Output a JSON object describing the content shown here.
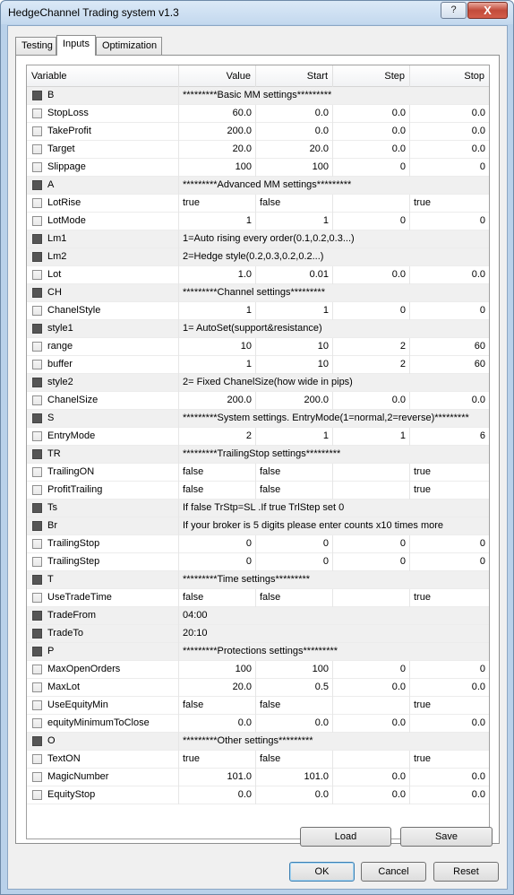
{
  "window": {
    "title": "HedgeChannel Trading system v1.3",
    "help_label": "?",
    "close_label": "X"
  },
  "tabs": [
    {
      "label": "Testing"
    },
    {
      "label": "Inputs"
    },
    {
      "label": "Optimization"
    }
  ],
  "columns": {
    "variable": "Variable",
    "value": "Value",
    "start": "Start",
    "step": "Step",
    "stop": "Stop"
  },
  "rows": [
    {
      "name": "B",
      "section": true,
      "text": "*********Basic MM settings*********"
    },
    {
      "name": "StopLoss",
      "cells": [
        "60.0",
        "0.0",
        "0.0",
        "0.0"
      ]
    },
    {
      "name": "TakeProfit",
      "cells": [
        "200.0",
        "0.0",
        "0.0",
        "0.0"
      ]
    },
    {
      "name": "Target",
      "cells": [
        "20.0",
        "20.0",
        "0.0",
        "0.0"
      ]
    },
    {
      "name": "Slippage",
      "cells": [
        "100",
        "100",
        "0",
        "0"
      ]
    },
    {
      "name": "A",
      "section": true,
      "text": "*********Advanced MM settings*********"
    },
    {
      "name": "LotRise",
      "bool": true,
      "cells": [
        "true",
        "false",
        "",
        "true"
      ]
    },
    {
      "name": "LotMode",
      "cells": [
        "1",
        "1",
        "0",
        "0"
      ]
    },
    {
      "name": "Lm1",
      "section": true,
      "text": "1=Auto rising every order(0.1,0.2,0.3...)"
    },
    {
      "name": "Lm2",
      "section": true,
      "text": "2=Hedge style(0.2,0.3,0.2,0.2...)"
    },
    {
      "name": "Lot",
      "cells": [
        "1.0",
        "0.01",
        "0.0",
        "0.0"
      ]
    },
    {
      "name": "CH",
      "section": true,
      "text": "*********Channel settings*********"
    },
    {
      "name": "ChanelStyle",
      "cells": [
        "1",
        "1",
        "0",
        "0"
      ]
    },
    {
      "name": "style1",
      "section": true,
      "text": "1= AutoSet(support&resistance)"
    },
    {
      "name": "range",
      "cells": [
        "10",
        "10",
        "2",
        "60"
      ]
    },
    {
      "name": "buffer",
      "cells": [
        "1",
        "10",
        "2",
        "60"
      ]
    },
    {
      "name": "style2",
      "section": true,
      "text": "2= Fixed ChanelSize(how wide in pips)"
    },
    {
      "name": "ChanelSize",
      "cells": [
        "200.0",
        "200.0",
        "0.0",
        "0.0"
      ]
    },
    {
      "name": "S",
      "section": true,
      "text": "*********System settings. EntryMode(1=normal,2=reverse)*********"
    },
    {
      "name": "EntryMode",
      "cells": [
        "2",
        "1",
        "1",
        "6"
      ]
    },
    {
      "name": "TR",
      "section": true,
      "text": "*********TrailingStop settings*********"
    },
    {
      "name": "TrailingON",
      "bool": true,
      "cells": [
        "false",
        "false",
        "",
        "true"
      ]
    },
    {
      "name": "ProfitTrailing",
      "bool": true,
      "cells": [
        "false",
        "false",
        "",
        "true"
      ]
    },
    {
      "name": "Ts",
      "section": true,
      "text": "If false TrStp=SL .If true TrlStep set 0"
    },
    {
      "name": "Br",
      "section": true,
      "text": "If your broker is 5 digits please enter counts x10 times more"
    },
    {
      "name": "TrailingStop",
      "cells": [
        "0",
        "0",
        "0",
        "0"
      ]
    },
    {
      "name": "TrailingStep",
      "cells": [
        "0",
        "0",
        "0",
        "0"
      ]
    },
    {
      "name": "T",
      "section": true,
      "text": "*********Time settings*********"
    },
    {
      "name": "UseTradeTime",
      "bool": true,
      "cells": [
        "false",
        "false",
        "",
        "true"
      ]
    },
    {
      "name": "TradeFrom",
      "section": true,
      "text": "04:00"
    },
    {
      "name": "TradeTo",
      "section": true,
      "text": "20:10"
    },
    {
      "name": "P",
      "section": true,
      "text": "*********Protections settings*********"
    },
    {
      "name": "MaxOpenOrders",
      "cells": [
        "100",
        "100",
        "0",
        "0"
      ]
    },
    {
      "name": "MaxLot",
      "cells": [
        "20.0",
        "0.5",
        "0.0",
        "0.0"
      ]
    },
    {
      "name": "UseEquityMin",
      "bool": true,
      "cells": [
        "false",
        "false",
        "",
        "true"
      ]
    },
    {
      "name": "equityMinimumToClose",
      "cells": [
        "0.0",
        "0.0",
        "0.0",
        "0.0"
      ]
    },
    {
      "name": "O",
      "section": true,
      "text": "*********Other settings*********"
    },
    {
      "name": "TextON",
      "bool": true,
      "cells": [
        "true",
        "false",
        "",
        "true"
      ]
    },
    {
      "name": "MagicNumber",
      "cells": [
        "101.0",
        "101.0",
        "0.0",
        "0.0"
      ]
    },
    {
      "name": "EquityStop",
      "cells": [
        "0.0",
        "0.0",
        "0.0",
        "0.0"
      ]
    }
  ],
  "buttons": {
    "load": "Load",
    "save": "Save",
    "ok": "OK",
    "cancel": "Cancel",
    "reset": "Reset"
  }
}
